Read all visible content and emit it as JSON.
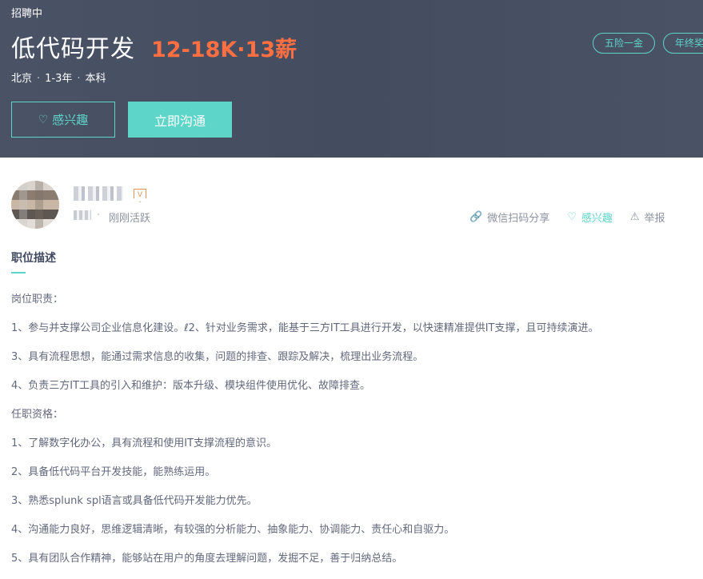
{
  "header": {
    "status": "招聘中",
    "job_title": "低代码开发",
    "salary": "12-18K·13薪",
    "meta": {
      "city": "北京",
      "experience": "1-3年",
      "degree": "本科"
    },
    "buttons": {
      "interest_icon": "♡",
      "interest": "感兴趣",
      "chat": "立即沟通"
    },
    "tags": [
      "五险一金",
      "年终奖"
    ]
  },
  "recruiter": {
    "avatar_icon": "avatar-image",
    "badge": "V",
    "sub_label": "R",
    "dot": "·",
    "active_status": "刚刚活跃"
  },
  "actions": {
    "share": {
      "icon": "🔗",
      "label": "微信扫码分享"
    },
    "interest": {
      "icon": "♡",
      "label": "感兴趣"
    },
    "report": {
      "icon": "⚠",
      "label": "举报"
    }
  },
  "section": {
    "title": "职位描述"
  },
  "description": [
    "岗位职责：",
    "1、参与并支撑公司企业信息化建设。ℓ2、针对业务需求，能基于三方IT工具进行开发，以快速精准提供IT支撑，且可持续演进。",
    "3、具有流程思想，能通过需求信息的收集，问题的排查、跟踪及解决，梳理出业务流程。",
    "4、负责三方IT工具的引入和维护：版本升级、模块组件使用优化、故障排查。",
    "任职资格：",
    "1、了解数字化办公，具有流程和使用IT支撑流程的意识。",
    "2、具备低代码平台开发技能，能熟练运用。",
    "3、熟悉splunk spl语言或具备低代码开发能力优先。",
    "4、沟通能力良好，思维逻辑清晰，有较强的分析能力、抽象能力、协调能力、责任心和自驱力。",
    "5、具有团队合作精神，能够站在用户的角度去理解问题，发掘不足，善于归纳总结。"
  ],
  "colors": {
    "accent": "#5dd5c8",
    "salary": "#ff6f42",
    "header_bg": "#474f63"
  }
}
